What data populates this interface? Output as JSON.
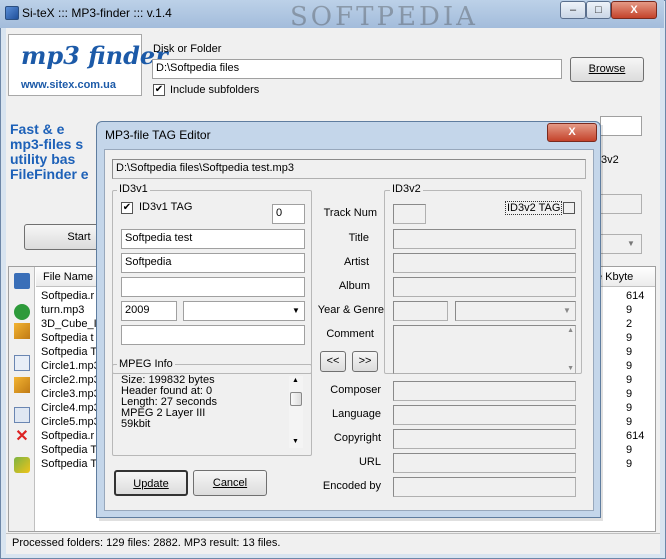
{
  "main_window": {
    "title": "Si-teX ::: MP3-finder ::: v.1.4",
    "watermark": "SOFTPEDIA",
    "minimize": "–",
    "maximize": "□",
    "close": "X"
  },
  "logo": {
    "text": "mp3 finder",
    "url": "www.sitex.com.ua"
  },
  "promo": {
    "line1": "Fast & e",
    "line2": "mp3-files s",
    "line3": "utility bas",
    "line4": "FileFinder e"
  },
  "search": {
    "disk_label": "Disk or Folder",
    "path_value": "D:\\Softpedia files",
    "browse_label": "Browse",
    "include_subfolders_label": "Include subfolders",
    "include_subfolders_checked": "✔",
    "start_label": "Start"
  },
  "file_list": {
    "col_file_name": "File Name",
    "col_kbyte": "e Kbyte",
    "rows": [
      {
        "name": "Softpedia.r",
        "size": "614"
      },
      {
        "name": "turn.mp3",
        "size": "9"
      },
      {
        "name": "3D_Cube_I",
        "size": "2"
      },
      {
        "name": "Softpedia t",
        "size": "9"
      },
      {
        "name": "Softpedia T",
        "size": "9"
      },
      {
        "name": "Circle1.mp3",
        "size": "9"
      },
      {
        "name": "Circle2.mp3",
        "size": "9"
      },
      {
        "name": "Circle3.mp3",
        "size": "9"
      },
      {
        "name": "Circle4.mp3",
        "size": "9"
      },
      {
        "name": "Circle5.mp3",
        "size": "9"
      },
      {
        "name": "Softpedia.r",
        "size": "614"
      },
      {
        "name": "Softpedia T",
        "size": "9"
      },
      {
        "name": "Softpedia T",
        "size": "9"
      }
    ]
  },
  "right_peek": {
    "v2": "3v2"
  },
  "status": {
    "text": "Processed folders: 129 files: 2882. MP3 result: 13 files."
  },
  "dialog": {
    "title": "MP3-file TAG Editor",
    "close": "X",
    "file_path": "D:\\Softpedia files\\Softpedia test.mp3",
    "id3v1": {
      "group_label": "ID3v1",
      "tag_label": "ID3v1 TAG",
      "tag_checked": "✔",
      "track_value": "0",
      "title_value": "Softpedia test",
      "artist_value": "Softpedia",
      "album_value": "",
      "year_value": "2009",
      "genre_value": "",
      "comment_value": ""
    },
    "labels": {
      "track": "Track Num",
      "title": "Title",
      "artist": "Artist",
      "album": "Album",
      "year_genre": "Year & Genre",
      "comment": "Comment",
      "copy_left": "<<",
      "copy_right": ">>",
      "composer": "Composer",
      "language": "Language",
      "copyright": "Copyright",
      "url": "URL",
      "encoded_by": "Encoded by"
    },
    "id3v2": {
      "group_label": "ID3v2",
      "tag_label": "ID3v2 TAG"
    },
    "mpeg": {
      "group_label": "MPEG Info",
      "lines": [
        "Size: 199832 bytes",
        "Header found at: 0",
        "Length: 27 seconds",
        "MPEG 2 Layer III",
        "59kbit"
      ]
    },
    "update_label": "Update",
    "cancel_label": "Cancel"
  }
}
